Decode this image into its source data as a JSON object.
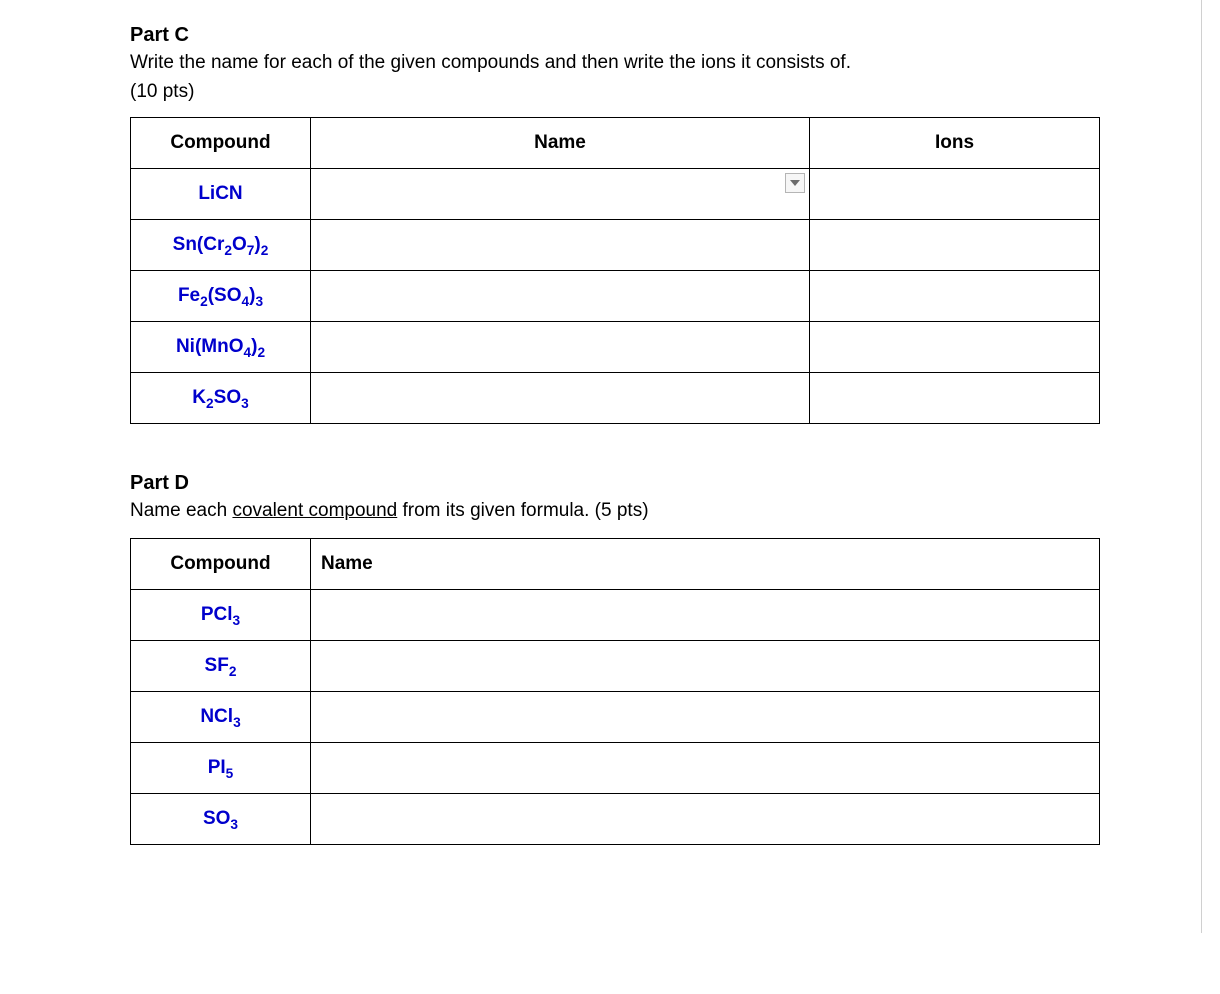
{
  "partC": {
    "heading": "Part C",
    "instructions": "Write the name for each of the given compounds and then write the ions it consists of.",
    "points": "(10 pts)",
    "headers": {
      "compound": "Compound",
      "name": "Name",
      "ions": "Ions"
    },
    "rows": [
      {
        "formula_html": "LiCN",
        "name": "",
        "ions": "",
        "has_dropdown": true
      },
      {
        "formula_html": "Sn(Cr<sub>2</sub>O<sub>7</sub>)<sub>2</sub>",
        "name": "",
        "ions": "",
        "has_dropdown": false
      },
      {
        "formula_html": "Fe<sub>2</sub>(SO<sub>4</sub>)<sub>3</sub>",
        "name": "",
        "ions": "",
        "has_dropdown": false
      },
      {
        "formula_html": "Ni(MnO<sub>4</sub>)<sub>2</sub>",
        "name": "",
        "ions": "",
        "has_dropdown": false
      },
      {
        "formula_html": "K<sub>2</sub>SO<sub>3</sub>",
        "name": "",
        "ions": "",
        "has_dropdown": false
      }
    ]
  },
  "partD": {
    "heading": "Part D",
    "instructions_pre": "Name each ",
    "instructions_underlined": "covalent compound",
    "instructions_post": " from its given formula. (5 pts)",
    "headers": {
      "compound": "Compound",
      "name": "Name"
    },
    "rows": [
      {
        "formula_html": "PCl<sub>3</sub>",
        "name": ""
      },
      {
        "formula_html": "SF<sub>2</sub>",
        "name": ""
      },
      {
        "formula_html": "NCl<sub>3</sub>",
        "name": ""
      },
      {
        "formula_html": "PI<sub>5</sub>",
        "name": ""
      },
      {
        "formula_html": "SO<sub>3</sub>",
        "name": ""
      }
    ]
  }
}
